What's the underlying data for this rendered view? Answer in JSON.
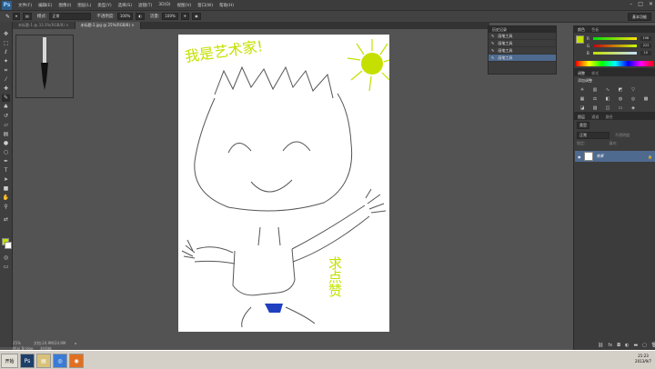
{
  "app": {
    "logo": "Ps"
  },
  "menu": [
    "文件(F)",
    "编辑(E)",
    "图像(I)",
    "图层(L)",
    "类型(Y)",
    "选择(S)",
    "滤镜(T)",
    "3D(D)",
    "视图(V)",
    "窗口(W)",
    "帮助(H)"
  ],
  "window_controls": {
    "minimize": "–",
    "maximize": "□",
    "close": "✕"
  },
  "options": {
    "mode_label": "模式:",
    "mode_value": "正常",
    "opacity_label": "不透明度:",
    "opacity_value": "100%",
    "flow_label": "流量:",
    "flow_value": "100%",
    "workspace": "基本功能"
  },
  "tabs": [
    {
      "label": "未标题-1 @ 33.3%(RGB/8) ×"
    },
    {
      "label": "未标题-2.jpg @ 25%(RGB/8) ×"
    }
  ],
  "status": {
    "zoom": "25%",
    "doc": "文档:24.9M/24.9M"
  },
  "bottom_tabs": [
    "Mini Bridge",
    "时间轴"
  ],
  "history": {
    "title": "历史记录",
    "items": [
      "画笔工具",
      "画笔工具",
      "画笔工具",
      "画笔工具"
    ]
  },
  "color_panel": {
    "tabs": [
      "颜色",
      "色板"
    ],
    "r": "196",
    "g": "222",
    "b": "10",
    "r_label": "R",
    "g_label": "G",
    "b_label": "B"
  },
  "adjustments": {
    "tabs": [
      "调整",
      "样式"
    ],
    "title": "添加调整"
  },
  "layers": {
    "tabs": [
      "图层",
      "通道",
      "路径"
    ],
    "kind_label": "类型",
    "blend": "正常",
    "opacity_label": "不透明度:",
    "fill_label": "填充:",
    "lock_label": "锁定:",
    "layer_name": "背景"
  },
  "drawing_text": {
    "top": "我是艺术家!",
    "right": "求点赞"
  },
  "taskbar": {
    "start": "开始",
    "time": "21:23",
    "date": "2013/9/7"
  },
  "colors": {
    "foreground": "#c5e000",
    "background": "#ffffff",
    "selection": "#4e6a8f"
  }
}
